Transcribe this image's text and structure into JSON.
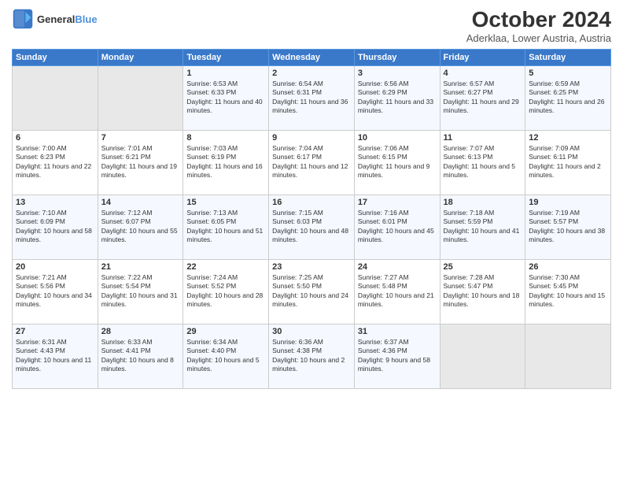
{
  "header": {
    "logo_line1": "General",
    "logo_line2": "Blue",
    "month": "October 2024",
    "location": "Aderklaa, Lower Austria, Austria"
  },
  "weekdays": [
    "Sunday",
    "Monday",
    "Tuesday",
    "Wednesday",
    "Thursday",
    "Friday",
    "Saturday"
  ],
  "weeks": [
    [
      {
        "num": "",
        "sunrise": "",
        "sunset": "",
        "daylight": ""
      },
      {
        "num": "",
        "sunrise": "",
        "sunset": "",
        "daylight": ""
      },
      {
        "num": "1",
        "sunrise": "Sunrise: 6:53 AM",
        "sunset": "Sunset: 6:33 PM",
        "daylight": "Daylight: 11 hours and 40 minutes."
      },
      {
        "num": "2",
        "sunrise": "Sunrise: 6:54 AM",
        "sunset": "Sunset: 6:31 PM",
        "daylight": "Daylight: 11 hours and 36 minutes."
      },
      {
        "num": "3",
        "sunrise": "Sunrise: 6:56 AM",
        "sunset": "Sunset: 6:29 PM",
        "daylight": "Daylight: 11 hours and 33 minutes."
      },
      {
        "num": "4",
        "sunrise": "Sunrise: 6:57 AM",
        "sunset": "Sunset: 6:27 PM",
        "daylight": "Daylight: 11 hours and 29 minutes."
      },
      {
        "num": "5",
        "sunrise": "Sunrise: 6:59 AM",
        "sunset": "Sunset: 6:25 PM",
        "daylight": "Daylight: 11 hours and 26 minutes."
      }
    ],
    [
      {
        "num": "6",
        "sunrise": "Sunrise: 7:00 AM",
        "sunset": "Sunset: 6:23 PM",
        "daylight": "Daylight: 11 hours and 22 minutes."
      },
      {
        "num": "7",
        "sunrise": "Sunrise: 7:01 AM",
        "sunset": "Sunset: 6:21 PM",
        "daylight": "Daylight: 11 hours and 19 minutes."
      },
      {
        "num": "8",
        "sunrise": "Sunrise: 7:03 AM",
        "sunset": "Sunset: 6:19 PM",
        "daylight": "Daylight: 11 hours and 16 minutes."
      },
      {
        "num": "9",
        "sunrise": "Sunrise: 7:04 AM",
        "sunset": "Sunset: 6:17 PM",
        "daylight": "Daylight: 11 hours and 12 minutes."
      },
      {
        "num": "10",
        "sunrise": "Sunrise: 7:06 AM",
        "sunset": "Sunset: 6:15 PM",
        "daylight": "Daylight: 11 hours and 9 minutes."
      },
      {
        "num": "11",
        "sunrise": "Sunrise: 7:07 AM",
        "sunset": "Sunset: 6:13 PM",
        "daylight": "Daylight: 11 hours and 5 minutes."
      },
      {
        "num": "12",
        "sunrise": "Sunrise: 7:09 AM",
        "sunset": "Sunset: 6:11 PM",
        "daylight": "Daylight: 11 hours and 2 minutes."
      }
    ],
    [
      {
        "num": "13",
        "sunrise": "Sunrise: 7:10 AM",
        "sunset": "Sunset: 6:09 PM",
        "daylight": "Daylight: 10 hours and 58 minutes."
      },
      {
        "num": "14",
        "sunrise": "Sunrise: 7:12 AM",
        "sunset": "Sunset: 6:07 PM",
        "daylight": "Daylight: 10 hours and 55 minutes."
      },
      {
        "num": "15",
        "sunrise": "Sunrise: 7:13 AM",
        "sunset": "Sunset: 6:05 PM",
        "daylight": "Daylight: 10 hours and 51 minutes."
      },
      {
        "num": "16",
        "sunrise": "Sunrise: 7:15 AM",
        "sunset": "Sunset: 6:03 PM",
        "daylight": "Daylight: 10 hours and 48 minutes."
      },
      {
        "num": "17",
        "sunrise": "Sunrise: 7:16 AM",
        "sunset": "Sunset: 6:01 PM",
        "daylight": "Daylight: 10 hours and 45 minutes."
      },
      {
        "num": "18",
        "sunrise": "Sunrise: 7:18 AM",
        "sunset": "Sunset: 5:59 PM",
        "daylight": "Daylight: 10 hours and 41 minutes."
      },
      {
        "num": "19",
        "sunrise": "Sunrise: 7:19 AM",
        "sunset": "Sunset: 5:57 PM",
        "daylight": "Daylight: 10 hours and 38 minutes."
      }
    ],
    [
      {
        "num": "20",
        "sunrise": "Sunrise: 7:21 AM",
        "sunset": "Sunset: 5:56 PM",
        "daylight": "Daylight: 10 hours and 34 minutes."
      },
      {
        "num": "21",
        "sunrise": "Sunrise: 7:22 AM",
        "sunset": "Sunset: 5:54 PM",
        "daylight": "Daylight: 10 hours and 31 minutes."
      },
      {
        "num": "22",
        "sunrise": "Sunrise: 7:24 AM",
        "sunset": "Sunset: 5:52 PM",
        "daylight": "Daylight: 10 hours and 28 minutes."
      },
      {
        "num": "23",
        "sunrise": "Sunrise: 7:25 AM",
        "sunset": "Sunset: 5:50 PM",
        "daylight": "Daylight: 10 hours and 24 minutes."
      },
      {
        "num": "24",
        "sunrise": "Sunrise: 7:27 AM",
        "sunset": "Sunset: 5:48 PM",
        "daylight": "Daylight: 10 hours and 21 minutes."
      },
      {
        "num": "25",
        "sunrise": "Sunrise: 7:28 AM",
        "sunset": "Sunset: 5:47 PM",
        "daylight": "Daylight: 10 hours and 18 minutes."
      },
      {
        "num": "26",
        "sunrise": "Sunrise: 7:30 AM",
        "sunset": "Sunset: 5:45 PM",
        "daylight": "Daylight: 10 hours and 15 minutes."
      }
    ],
    [
      {
        "num": "27",
        "sunrise": "Sunrise: 6:31 AM",
        "sunset": "Sunset: 4:43 PM",
        "daylight": "Daylight: 10 hours and 11 minutes."
      },
      {
        "num": "28",
        "sunrise": "Sunrise: 6:33 AM",
        "sunset": "Sunset: 4:41 PM",
        "daylight": "Daylight: 10 hours and 8 minutes."
      },
      {
        "num": "29",
        "sunrise": "Sunrise: 6:34 AM",
        "sunset": "Sunset: 4:40 PM",
        "daylight": "Daylight: 10 hours and 5 minutes."
      },
      {
        "num": "30",
        "sunrise": "Sunrise: 6:36 AM",
        "sunset": "Sunset: 4:38 PM",
        "daylight": "Daylight: 10 hours and 2 minutes."
      },
      {
        "num": "31",
        "sunrise": "Sunrise: 6:37 AM",
        "sunset": "Sunset: 4:36 PM",
        "daylight": "Daylight: 9 hours and 58 minutes."
      },
      {
        "num": "",
        "sunrise": "",
        "sunset": "",
        "daylight": ""
      },
      {
        "num": "",
        "sunrise": "",
        "sunset": "",
        "daylight": ""
      }
    ]
  ]
}
